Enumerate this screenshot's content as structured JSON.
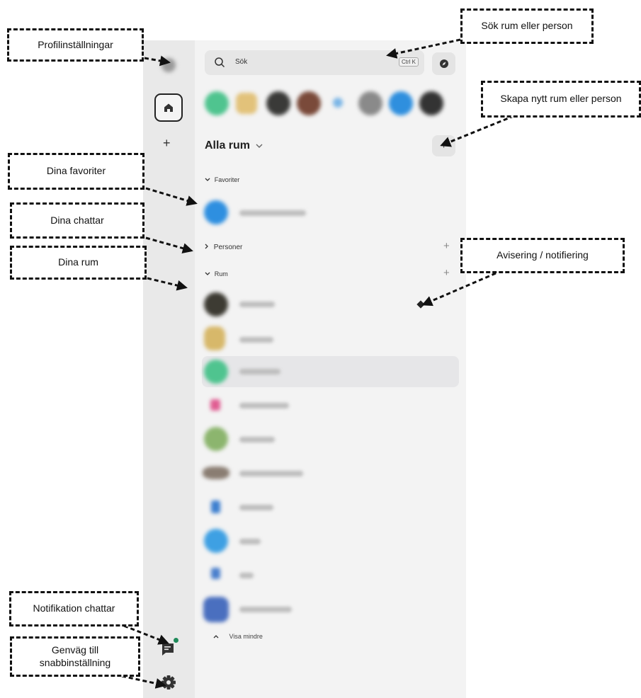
{
  "search": {
    "placeholder": "Sök",
    "shortcut": "Ctrl K"
  },
  "rooms_header": {
    "title": "Alla rum"
  },
  "sections": {
    "favorites": "Favoriter",
    "people": "Personer",
    "rooms": "Rum"
  },
  "show_less": "Visa mindre",
  "annotations": {
    "profile": "Profilinställningar",
    "search": "Sök rum eller person",
    "create": "Skapa nytt rum eller person",
    "favorites": "Dina favoriter",
    "chats": "Dina chattar",
    "rooms": "Dina rum",
    "notification": "Avisering / notifiering",
    "chat_notifications": "Notifikation chattar",
    "quick_settings_line1": "Genväg till",
    "quick_settings_line2": "snabbinställning"
  },
  "colors": {
    "rail_bg": "#e9e9e9",
    "panel_bg": "#f3f3f3",
    "selected_row": "#e8e8ea",
    "unread_dot": "#1f8a5a"
  },
  "icons": [
    "home-icon",
    "plus-icon",
    "search-icon",
    "compass-icon",
    "chevron-down-icon",
    "chevron-right-icon",
    "chevron-up-icon",
    "chat-icon",
    "gear-icon"
  ]
}
